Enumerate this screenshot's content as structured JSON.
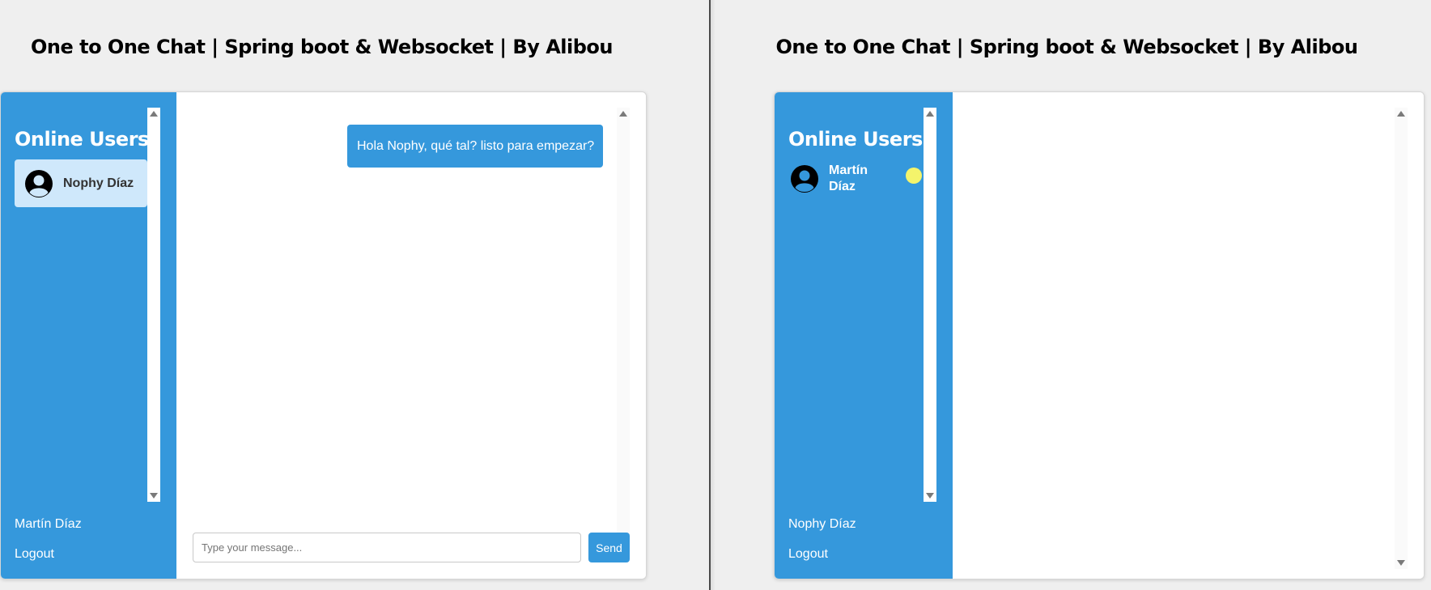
{
  "left": {
    "title": "One to One Chat | Spring boot & Websocket | By Alibou",
    "sidebar": {
      "heading": "Online Users",
      "users": [
        {
          "name": "Nophy Díaz",
          "selected": true
        }
      ],
      "current_user": "Martín Díaz",
      "logout_label": "Logout"
    },
    "chat": {
      "messages": [
        {
          "text": "Hola Nophy, qué tal? listo para empezar?",
          "direction": "sent"
        }
      ],
      "input": {
        "value": "",
        "placeholder": "Type your message..."
      },
      "send_label": "Send"
    }
  },
  "right": {
    "title": "One to One Chat | Spring boot & Websocket | By Alibou",
    "sidebar": {
      "heading": "Online Users",
      "users": [
        {
          "name": "Martín Díaz",
          "selected": false,
          "new_message": true
        }
      ],
      "current_user": "Nophy Díaz",
      "logout_label": "Logout"
    },
    "chat": {
      "messages": []
    }
  },
  "colors": {
    "accent": "#3598dc",
    "selected_user_bg": "#cfe8fb",
    "notification_dot": "#f4f46b",
    "page_bg": "#efefef"
  },
  "icons": {
    "avatar": "user-avatar-icon",
    "scroll_up": "triangle-up",
    "scroll_down": "triangle-down"
  }
}
